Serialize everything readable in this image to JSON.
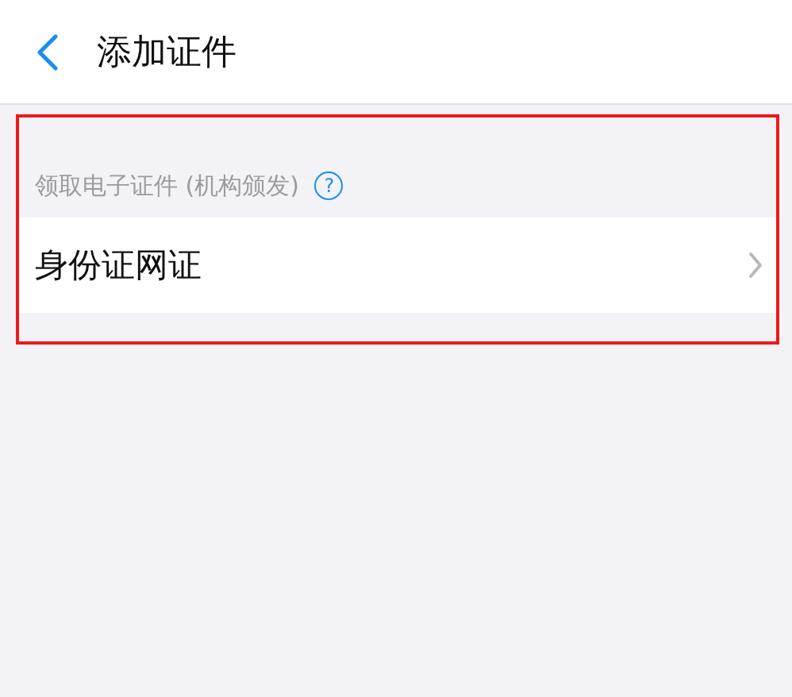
{
  "nav_bar": {
    "title": "添加证件"
  },
  "section": {
    "highlighted": true,
    "header": "领取电子证件 (机构颁发)",
    "help": "?",
    "items": [
      {
        "label": "身份证网证"
      }
    ]
  }
}
